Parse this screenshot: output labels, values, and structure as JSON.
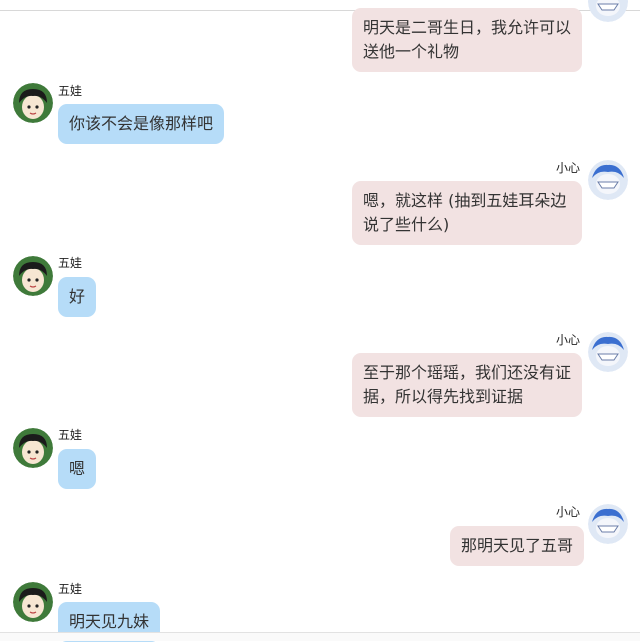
{
  "contacts": {
    "left_name": "五娃",
    "right_name": "小心"
  },
  "messages": [
    {
      "side": "right",
      "text": "明天是二哥生日，我允许可以送他一个礼物",
      "show_header": false
    },
    {
      "side": "left",
      "text": "你该不会是像那样吧",
      "show_header": true
    },
    {
      "side": "right",
      "text": "嗯，就这样 (抽到五娃耳朵边说了些什么)",
      "show_header": true
    },
    {
      "side": "left",
      "text": "好",
      "show_header": true
    },
    {
      "side": "right",
      "text": "至于那个瑶瑶，我们还没有证据，所以得先找到证据",
      "show_header": true
    },
    {
      "side": "left",
      "text": "嗯",
      "show_header": true
    },
    {
      "side": "right",
      "text": "那明天见了五哥",
      "show_header": true
    },
    {
      "side": "left",
      "text": "明天见九妹",
      "show_header": true
    }
  ],
  "colors": {
    "left_bubble": "#b6dcf8",
    "right_bubble": "#f2e2e2",
    "background": "#ffffff"
  },
  "icons": {
    "left_avatar": "cartoon-boy-avatar",
    "right_avatar": "blue-haired-masked-avatar"
  }
}
